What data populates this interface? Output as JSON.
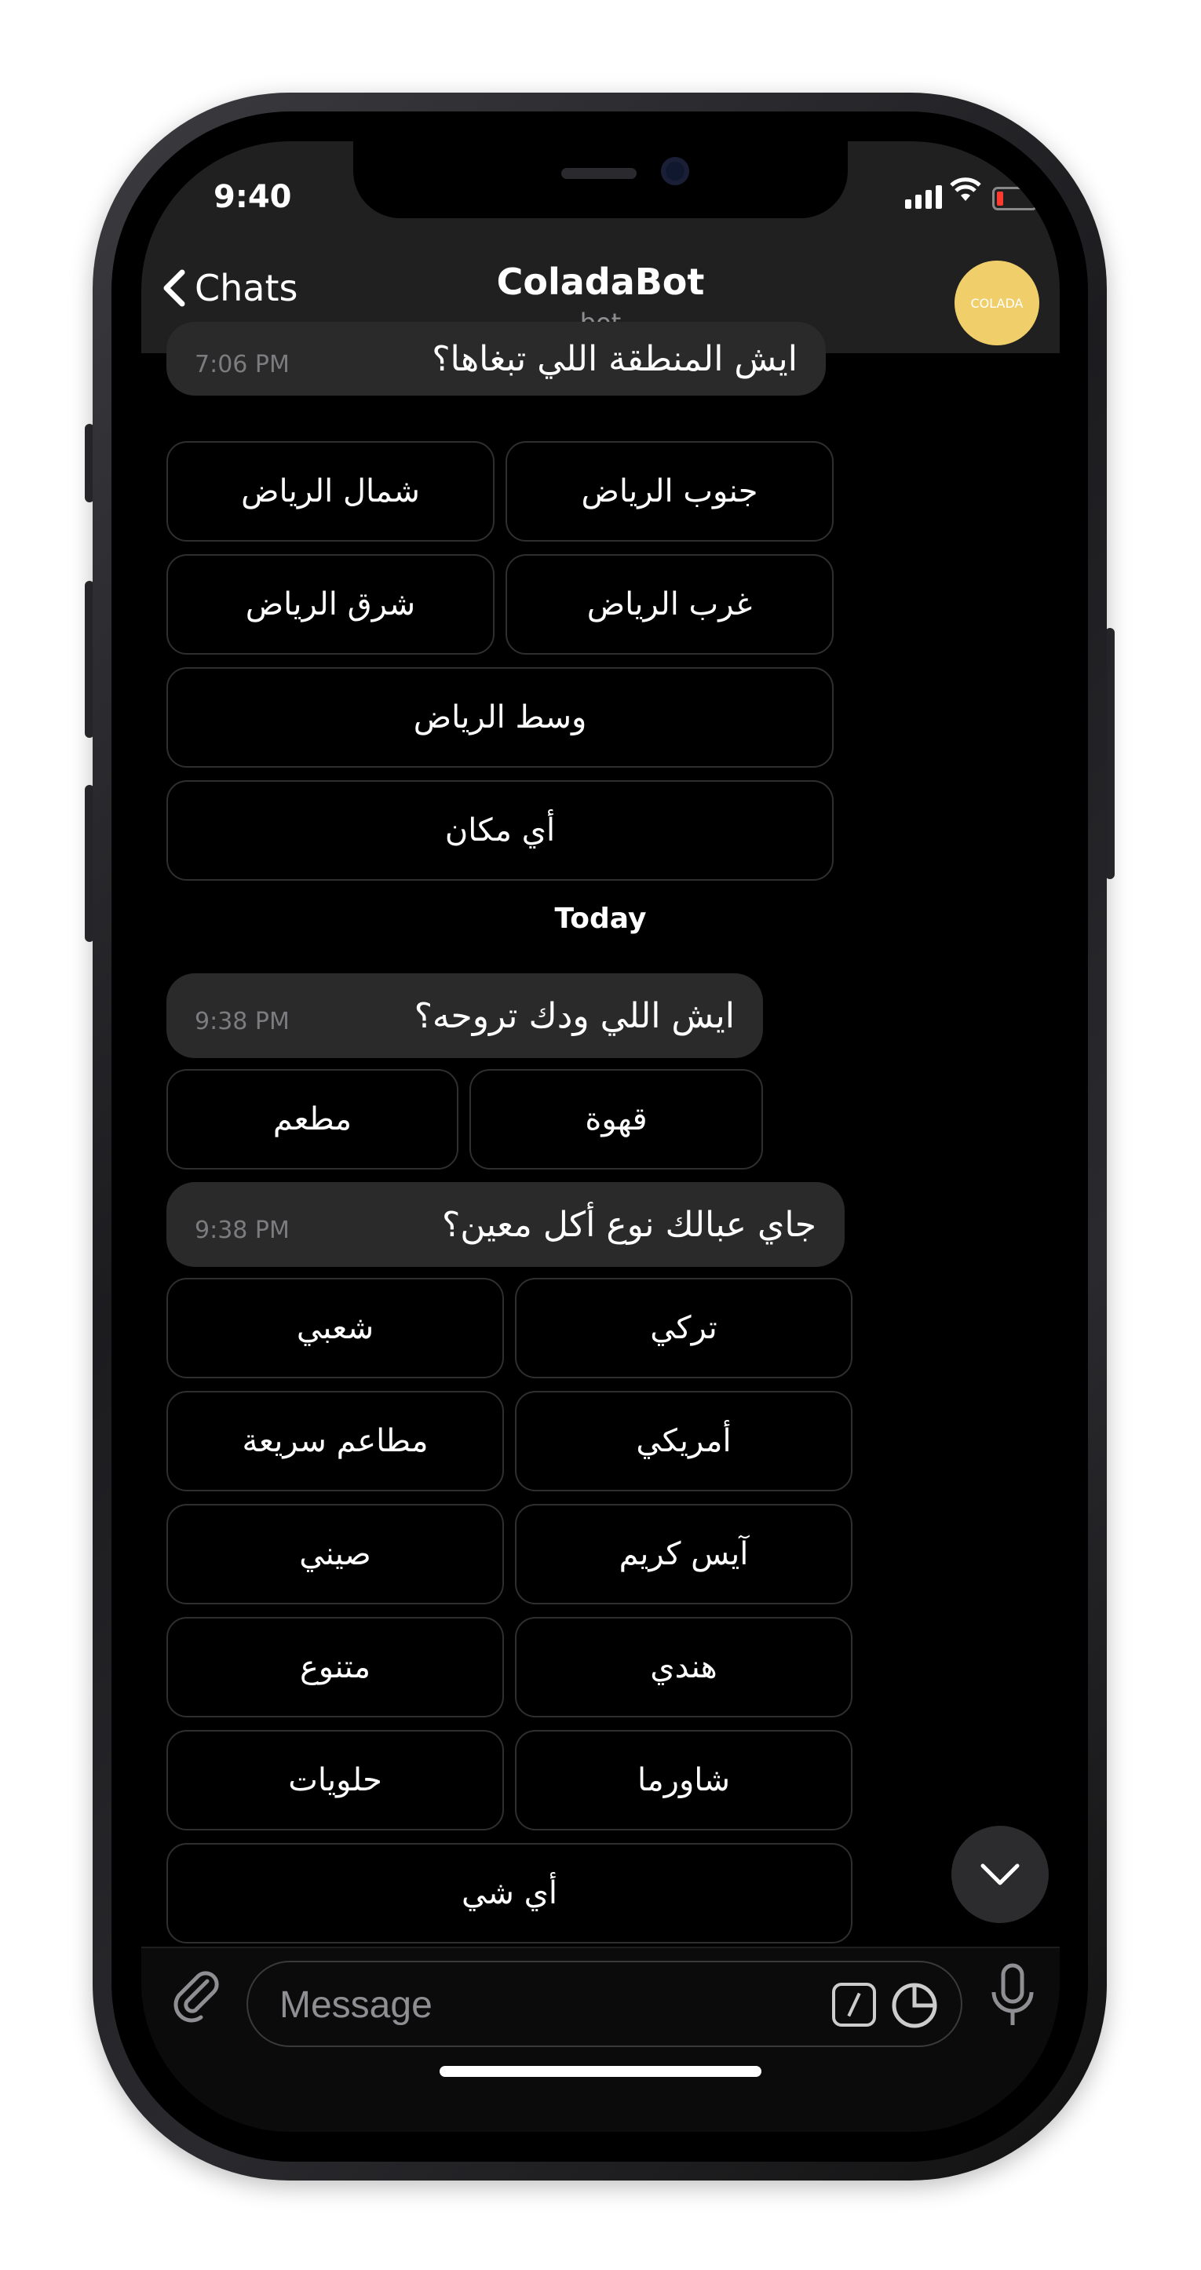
{
  "status": {
    "time": "9:40"
  },
  "nav": {
    "back_label": "Chats",
    "title": "ColadaBot",
    "subtitle": "bot",
    "avatar_text": "COLADA"
  },
  "messages": [
    {
      "text": "ايش المنطقة اللي تبغاها؟",
      "time": "7:06 PM"
    },
    {
      "text": "ايش اللي ودك تروحه؟",
      "time": "9:38 PM"
    },
    {
      "text": "جاي عبالك نوع أكل معين؟",
      "time": "9:38 PM"
    }
  ],
  "keyboards": {
    "area": [
      "شمال الرياض",
      "جنوب الرياض",
      "شرق الرياض",
      "غرب الرياض",
      "وسط الرياض",
      "أي مكان"
    ],
    "place": [
      "مطعم",
      "قهوة"
    ],
    "food": [
      "شعبي",
      "تركي",
      "مطاعم سريعة",
      "أمريكي",
      "صيني",
      "آيس كريم",
      "متنوع",
      "هندي",
      "حلويات",
      "شاورما",
      "أي شي"
    ]
  },
  "day_separator": "Today",
  "input": {
    "placeholder": "Message"
  },
  "icons": [
    "chevron-left-icon",
    "signal-icon",
    "wifi-icon",
    "battery-icon",
    "paperclip-icon",
    "bot-command-icon",
    "sticker-icon",
    "microphone-icon",
    "chevron-down-icon"
  ],
  "colors": {
    "avatar": "#f0cf6b",
    "bubble": "#2a2a2a",
    "battery_low": "#ff3b30"
  }
}
